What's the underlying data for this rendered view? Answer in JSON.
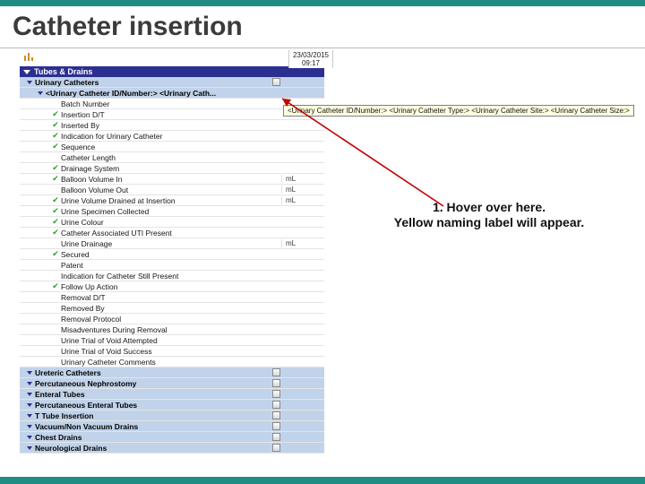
{
  "slide": {
    "title": "Catheter insertion"
  },
  "date_header": {
    "date": "23/03/2015",
    "time": "09:17"
  },
  "section": {
    "title": "Tubes & Drains"
  },
  "subheader": {
    "title": "Urinary Catheters"
  },
  "urinary_id_row": {
    "label": "<Urinary Catheter ID/Number:>  <Urinary Cath..."
  },
  "tooltip": "<Urinary Catheter ID/Number:> <Urinary Catheter Type:> <Urinary Catheter Site:> <Urinary Catheter Size:>",
  "items": [
    {
      "label": "Batch Number",
      "check": false,
      "unit": ""
    },
    {
      "label": "Insertion D/T",
      "check": true,
      "unit": ""
    },
    {
      "label": "Inserted By",
      "check": true,
      "unit": ""
    },
    {
      "label": "Indication for Urinary Catheter",
      "check": true,
      "unit": ""
    },
    {
      "label": "Sequence",
      "check": true,
      "unit": ""
    },
    {
      "label": "Catheter Length",
      "check": false,
      "unit": ""
    },
    {
      "label": "Drainage System",
      "check": true,
      "unit": ""
    },
    {
      "label": "Balloon Volume In",
      "check": true,
      "unit": "mL"
    },
    {
      "label": "Balloon Volume Out",
      "check": false,
      "unit": "mL"
    },
    {
      "label": "Urine Volume Drained at Insertion",
      "check": true,
      "unit": "mL"
    },
    {
      "label": "Urine Specimen Collected",
      "check": true,
      "unit": ""
    },
    {
      "label": "Urine Colour",
      "check": true,
      "unit": ""
    },
    {
      "label": "Catheter Associated UTI Present",
      "check": true,
      "unit": ""
    },
    {
      "label": "Urine Drainage",
      "check": false,
      "unit": "mL"
    },
    {
      "label": "Secured",
      "check": true,
      "unit": ""
    },
    {
      "label": "Patent",
      "check": false,
      "unit": ""
    },
    {
      "label": "Indication for Catheter Still Present",
      "check": false,
      "unit": ""
    },
    {
      "label": "Follow Up Action",
      "check": true,
      "unit": ""
    },
    {
      "label": "Removal D/T",
      "check": false,
      "unit": ""
    },
    {
      "label": "Removed By",
      "check": false,
      "unit": ""
    },
    {
      "label": "Removal Protocol",
      "check": false,
      "unit": ""
    },
    {
      "label": "Misadventures During Removal",
      "check": false,
      "unit": ""
    },
    {
      "label": "Urine Trial of Void Attempted",
      "check": false,
      "unit": ""
    },
    {
      "label": "Urine Trial of Void Success",
      "check": false,
      "unit": ""
    },
    {
      "label": "Urinary Catheter Comments",
      "check": false,
      "unit": ""
    }
  ],
  "categories": [
    {
      "label": "Ureteric Catheters"
    },
    {
      "label": "Percutaneous Nephrostomy"
    },
    {
      "label": "Enteral Tubes"
    },
    {
      "label": "Percutaneous Enteral Tubes"
    },
    {
      "label": "T Tube Insertion"
    },
    {
      "label": "Vacuum/Non Vacuum Drains"
    },
    {
      "label": "Chest Drains"
    },
    {
      "label": "Neurological Drains"
    }
  ],
  "annotation": {
    "line1": "1.  Hover over here.",
    "line2": "Yellow naming label will appear."
  }
}
